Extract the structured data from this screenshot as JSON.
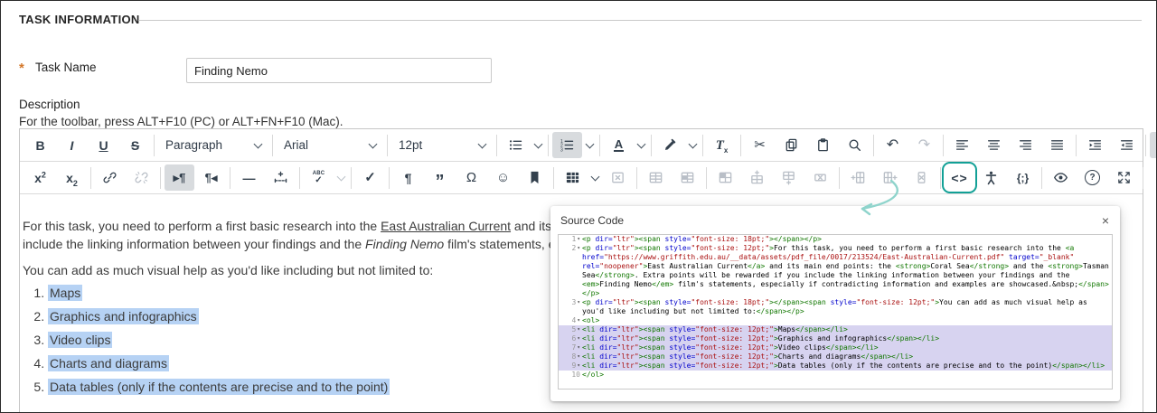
{
  "page": {
    "section_title": "TASK INFORMATION",
    "task_name": {
      "required_marker": "*",
      "label": "Task Name",
      "value": "Finding Nemo"
    },
    "description_label": "Description",
    "toolbar_hint": "For the toolbar, press ALT+F10 (PC) or ALT+FN+F10 (Mac)."
  },
  "colors": {
    "annotation": "#12a096",
    "annotation_arrow": "#8fd4cc",
    "editor_selection": "#b6d2f4",
    "code_selection": "#d7d3f0",
    "code_tag": "#117700",
    "code_attribute": "#0000cc",
    "code_string": "#aa1111",
    "required_orange": "#d4782a"
  },
  "editor": {
    "toolbar": {
      "rows": [
        [
          [
            {
              "name": "bold",
              "icon": "bold"
            },
            {
              "name": "italic",
              "icon": "italic"
            },
            {
              "name": "underline",
              "icon": "underline"
            },
            {
              "name": "strikethrough",
              "icon": "strikethrough"
            }
          ],
          [
            {
              "name": "blocks",
              "type": "select",
              "text": "Paragraph"
            }
          ],
          [
            {
              "name": "fontfamily",
              "type": "select",
              "text": "Arial"
            }
          ],
          [
            {
              "name": "fontsize",
              "type": "select",
              "text": "12pt"
            }
          ],
          [
            {
              "name": "bullist",
              "icon": "bullist",
              "chevron": true
            }
          ],
          [
            {
              "name": "numlist",
              "icon": "numlist",
              "chevron": true,
              "state": "active"
            }
          ],
          [
            {
              "name": "forecolor",
              "icon": "forecolor",
              "chevron": true
            }
          ],
          [
            {
              "name": "backcolor",
              "icon": "backcolor",
              "chevron": true
            }
          ],
          [
            {
              "name": "removeformat",
              "icon": "removeformat"
            }
          ],
          [
            {
              "name": "cut",
              "icon": "cut"
            },
            {
              "name": "copy",
              "icon": "copy"
            },
            {
              "name": "paste",
              "icon": "paste"
            },
            {
              "name": "searchreplace",
              "icon": "search"
            }
          ],
          [
            {
              "name": "undo",
              "icon": "undo"
            },
            {
              "name": "redo",
              "icon": "redo",
              "state": "disabled"
            }
          ],
          [
            {
              "name": "align-left",
              "icon": "alignleft"
            },
            {
              "name": "align-center",
              "icon": "aligncenter"
            },
            {
              "name": "align-right",
              "icon": "alignright"
            },
            {
              "name": "align-justify",
              "icon": "justify"
            }
          ],
          [
            {
              "name": "indent",
              "icon": "indent"
            },
            {
              "name": "outdent",
              "icon": "outdent"
            }
          ],
          [
            {
              "name": "more-options",
              "icon": "more",
              "state": "active"
            }
          ]
        ],
        [
          [
            {
              "name": "superscript",
              "icon": "superscript"
            },
            {
              "name": "subscript",
              "icon": "subscript"
            }
          ],
          [
            {
              "name": "insert-link",
              "icon": "link"
            },
            {
              "name": "unlink",
              "icon": "unlink",
              "state": "disabled"
            }
          ],
          [
            {
              "name": "ltr",
              "icon": "ltr",
              "state": "active"
            },
            {
              "name": "rtl",
              "icon": "rtl"
            }
          ],
          [
            {
              "name": "horizontal-rule",
              "icon": "hr"
            },
            {
              "name": "page-break",
              "icon": "pagebreak"
            }
          ],
          [
            {
              "name": "spellcheck",
              "icon": "spellcheck",
              "chevron": true,
              "chevron_state": "disabled"
            }
          ],
          [
            {
              "name": "spellchecker-toggle",
              "icon": "check"
            }
          ],
          [
            {
              "name": "visual-chars",
              "icon": "visualchars"
            },
            {
              "name": "blockquote",
              "icon": "blockquote"
            },
            {
              "name": "special-character",
              "icon": "charmap"
            },
            {
              "name": "emoticons",
              "icon": "emoticons"
            },
            {
              "name": "anchor",
              "icon": "anchor"
            }
          ],
          [
            {
              "name": "table",
              "icon": "table",
              "chevron": true
            },
            {
              "name": "delete-table",
              "icon": "deletetable",
              "state": "disabled"
            }
          ],
          [
            {
              "name": "table-row-properties",
              "icon": "rowprops",
              "state": "disabled"
            },
            {
              "name": "table-cell-properties",
              "icon": "cellprops",
              "state": "disabled"
            }
          ],
          [
            {
              "name": "merge-cells",
              "icon": "mergecells",
              "state": "disabled"
            },
            {
              "name": "insert-row-above",
              "icon": "insertrowabove",
              "state": "disabled"
            },
            {
              "name": "insert-row-below",
              "icon": "insertrowbelow",
              "state": "disabled"
            },
            {
              "name": "delete-row",
              "icon": "deleterow",
              "state": "disabled"
            }
          ],
          [
            {
              "name": "insert-column-before",
              "icon": "insertcolbefore",
              "state": "disabled"
            },
            {
              "name": "insert-column-after",
              "icon": "insertcolafter",
              "state": "disabled"
            },
            {
              "name": "delete-column",
              "icon": "deletecol",
              "state": "disabled"
            }
          ],
          [
            {
              "name": "source-code",
              "icon": "sourcecode",
              "annotated": true
            },
            {
              "name": "accessibility-checker",
              "icon": "accessibility"
            },
            {
              "name": "code-sample",
              "icon": "codesample"
            }
          ],
          [
            {
              "name": "preview",
              "icon": "preview"
            },
            {
              "name": "help",
              "icon": "help"
            },
            {
              "name": "fullscreen",
              "icon": "fullscreen"
            }
          ],
          [
            {
              "name": "insert-content",
              "icon": "insert"
            }
          ]
        ]
      ]
    },
    "content": {
      "paragraph1_lines": [
        {
          "segments": [
            {
              "t": "text",
              "s": "For this task, you need to perform a first basic research into the "
            },
            {
              "t": "link",
              "s": "East Australian Current"
            },
            {
              "t": "text",
              "s": " and its main end points: the "
            },
            {
              "t": "bold",
              "s": "Coral Sea"
            },
            {
              "t": "text",
              "s": " and the "
            },
            {
              "t": "bold",
              "s": "Tasman Sea"
            },
            {
              "t": "text",
              "s": ". Extra points will be rewarded if you"
            }
          ]
        },
        {
          "segments": [
            {
              "t": "text",
              "s": "include the linking information between your findings and the "
            },
            {
              "t": "italic",
              "s": "Finding Nemo"
            },
            {
              "t": "text",
              "s": " film's statements, especially if contradicting information and examples are showcased."
            }
          ]
        }
      ],
      "paragraph2": "You can add as much visual help as you'd like including but not limited to:",
      "list_items": [
        "Maps",
        "Graphics and infographics",
        "Video clips",
        "Charts and diagrams",
        "Data tables (only if the contents are precise and to the point)"
      ]
    }
  },
  "source_dialog": {
    "title": "Source Code",
    "close": "×",
    "code_lines": [
      {
        "num": 1,
        "fold": true,
        "selected": false,
        "segs": [
          [
            "tag",
            "<p"
          ],
          [
            "attr",
            " dir="
          ],
          [
            "str",
            "\"ltr\""
          ],
          [
            "tag",
            "><span"
          ],
          [
            "attr",
            " style="
          ],
          [
            "str",
            "\"font-size: 18pt;\""
          ],
          [
            "tag",
            "></span></p>"
          ]
        ]
      },
      {
        "num": 2,
        "fold": true,
        "selected": false,
        "segs": [
          [
            "tag",
            "<p"
          ],
          [
            "attr",
            " dir="
          ],
          [
            "str",
            "\"ltr\""
          ],
          [
            "tag",
            "><span"
          ],
          [
            "attr",
            " style="
          ],
          [
            "str",
            "\"font-size: 12pt;\""
          ],
          [
            "tag",
            ">"
          ],
          [
            "text",
            "For this task, you need to perform a first basic research into the "
          ],
          [
            "tag",
            "<a"
          ],
          [
            "attr",
            " href="
          ],
          [
            "str",
            "\"https://www.griffith.edu.au/__data/assets/pdf_file/0017/213524/East-Australian-Current.pdf\""
          ],
          [
            "attr",
            " target="
          ],
          [
            "str",
            "\"_blank\""
          ],
          [
            "attr",
            " rel="
          ],
          [
            "str",
            "\"noopener\""
          ],
          [
            "tag",
            ">"
          ],
          [
            "text",
            "East Australian Current"
          ],
          [
            "tag",
            "</a>"
          ],
          [
            "text",
            " and its main end points: the "
          ],
          [
            "tag",
            "<strong>"
          ],
          [
            "text",
            "Coral Sea"
          ],
          [
            "tag",
            "</strong>"
          ],
          [
            "text",
            " and the "
          ],
          [
            "tag",
            "<strong>"
          ],
          [
            "text",
            "Tasman Sea"
          ],
          [
            "tag",
            "</strong>"
          ],
          [
            "text",
            ". Extra points will be rewarded if you include the linking information between your findings and the "
          ],
          [
            "tag",
            "<em>"
          ],
          [
            "text",
            "Finding Nemo"
          ],
          [
            "tag",
            "</em>"
          ],
          [
            "text",
            " film's statements, especially if contradicting information and examples are showcased.&nbsp;"
          ],
          [
            "tag",
            "</span></p>"
          ]
        ]
      },
      {
        "num": 3,
        "fold": true,
        "selected": false,
        "segs": [
          [
            "tag",
            "<p"
          ],
          [
            "attr",
            " dir="
          ],
          [
            "str",
            "\"ltr\""
          ],
          [
            "tag",
            "><span"
          ],
          [
            "attr",
            " style="
          ],
          [
            "str",
            "\"font-size: 18pt;\""
          ],
          [
            "tag",
            "></span><span"
          ],
          [
            "attr",
            " style="
          ],
          [
            "str",
            "\"font-size: 12pt;\""
          ],
          [
            "tag",
            ">"
          ],
          [
            "text",
            "You can add as much visual help as you'd like including but not limited to:"
          ],
          [
            "tag",
            "</span></p>"
          ]
        ]
      },
      {
        "num": 4,
        "fold": true,
        "selected": false,
        "segs": [
          [
            "tag",
            "<ol>"
          ]
        ]
      },
      {
        "num": 5,
        "fold": true,
        "selected": true,
        "segs": [
          [
            "tag",
            "<li"
          ],
          [
            "attr",
            " dir="
          ],
          [
            "str",
            "\"ltr\""
          ],
          [
            "tag",
            "><span"
          ],
          [
            "attr",
            " style="
          ],
          [
            "str",
            "\"font-size: 12pt;\""
          ],
          [
            "tag",
            ">"
          ],
          [
            "text",
            "Maps"
          ],
          [
            "tag",
            "</span></li>"
          ]
        ]
      },
      {
        "num": 6,
        "fold": true,
        "selected": true,
        "segs": [
          [
            "tag",
            "<li"
          ],
          [
            "attr",
            " dir="
          ],
          [
            "str",
            "\"ltr\""
          ],
          [
            "tag",
            "><span"
          ],
          [
            "attr",
            " style="
          ],
          [
            "str",
            "\"font-size: 12pt;\""
          ],
          [
            "tag",
            ">"
          ],
          [
            "text",
            "Graphics and infographics"
          ],
          [
            "tag",
            "</span></li>"
          ]
        ]
      },
      {
        "num": 7,
        "fold": true,
        "selected": true,
        "segs": [
          [
            "tag",
            "<li"
          ],
          [
            "attr",
            " dir="
          ],
          [
            "str",
            "\"ltr\""
          ],
          [
            "tag",
            "><span"
          ],
          [
            "attr",
            " style="
          ],
          [
            "str",
            "\"font-size: 12pt;\""
          ],
          [
            "tag",
            ">"
          ],
          [
            "text",
            "Video clips"
          ],
          [
            "tag",
            "</span></li>"
          ]
        ]
      },
      {
        "num": 8,
        "fold": true,
        "selected": true,
        "segs": [
          [
            "tag",
            "<li"
          ],
          [
            "attr",
            " dir="
          ],
          [
            "str",
            "\"ltr\""
          ],
          [
            "tag",
            "><span"
          ],
          [
            "attr",
            " style="
          ],
          [
            "str",
            "\"font-size: 12pt;\""
          ],
          [
            "tag",
            ">"
          ],
          [
            "text",
            "Charts and diagrams"
          ],
          [
            "tag",
            "</span></li>"
          ]
        ]
      },
      {
        "num": 9,
        "fold": true,
        "selected": true,
        "segs": [
          [
            "tag",
            "<li"
          ],
          [
            "attr",
            " dir="
          ],
          [
            "str",
            "\"ltr\""
          ],
          [
            "tag",
            "><span"
          ],
          [
            "attr",
            " style="
          ],
          [
            "str",
            "\"font-size: 12pt;\""
          ],
          [
            "tag",
            ">"
          ],
          [
            "text",
            "Data tables (only if the contents are precise and to the point)"
          ],
          [
            "tag",
            "</span></li>"
          ]
        ]
      },
      {
        "num": 10,
        "fold": false,
        "selected": false,
        "segs": [
          [
            "tag",
            "</ol>"
          ]
        ]
      }
    ]
  }
}
